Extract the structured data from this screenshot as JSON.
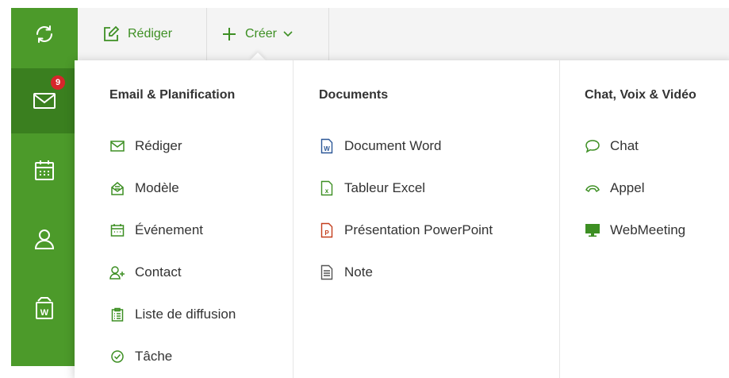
{
  "sidebar": {
    "mail_badge": "9"
  },
  "toolbar": {
    "compose_label": "Rédiger",
    "create_label": "Créer"
  },
  "menu": {
    "columns": [
      {
        "title": "Email & Planification",
        "items": [
          {
            "label": "Rédiger",
            "icon": "mail-icon"
          },
          {
            "label": "Modèle",
            "icon": "template-icon"
          },
          {
            "label": "Événement",
            "icon": "calendar-icon"
          },
          {
            "label": "Contact",
            "icon": "add-contact-icon"
          },
          {
            "label": "Liste de diffusion",
            "icon": "mailing-list-icon"
          },
          {
            "label": "Tâche",
            "icon": "task-icon"
          }
        ]
      },
      {
        "title": "Documents",
        "items": [
          {
            "label": "Document Word",
            "icon": "word-doc-icon"
          },
          {
            "label": "Tableur Excel",
            "icon": "excel-doc-icon"
          },
          {
            "label": "Présentation PowerPoint",
            "icon": "powerpoint-doc-icon"
          },
          {
            "label": "Note",
            "icon": "note-icon"
          }
        ]
      },
      {
        "title": "Chat, Voix & Vidéo",
        "items": [
          {
            "label": "Chat",
            "icon": "chat-icon"
          },
          {
            "label": "Appel",
            "icon": "phone-icon"
          },
          {
            "label": "WebMeeting",
            "icon": "monitor-icon"
          }
        ]
      }
    ]
  },
  "colors": {
    "sidebar": "#4c9a2a",
    "sidebar_active": "#3a7f1f",
    "accent": "#3d8f23",
    "badge": "#d6262b",
    "word": "#2b5797",
    "powerpoint": "#c43e1c"
  }
}
